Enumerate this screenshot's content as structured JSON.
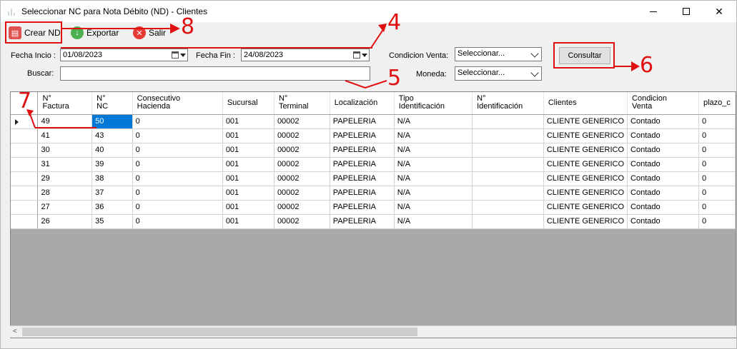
{
  "window": {
    "title": "Seleccionar NC para Nota Débito (ND) - Clientes",
    "minimize_glyph": "—",
    "maximize_glyph": "☐",
    "close_glyph": "✕"
  },
  "toolbar": {
    "crear_label": "Crear ND",
    "exportar_label": "Exportar",
    "salir_label": "Salir"
  },
  "filters": {
    "fecha_inicio_label": "Fecha Incio :",
    "fecha_inicio_value": "01/08/2023",
    "fecha_fin_label": "Fecha Fin :",
    "fecha_fin_value": "24/08/2023",
    "buscar_label": "Buscar:",
    "buscar_value": "",
    "condicion_label": "Condicion Venta:",
    "condicion_value": "Seleccionar...",
    "moneda_label": "Moneda:",
    "moneda_value": "Seleccionar...",
    "consultar_label": "Consultar"
  },
  "annotations": {
    "n4": "4",
    "n5": "5",
    "n6": "6",
    "n7": "7",
    "n8": "8"
  },
  "grid": {
    "columns": [
      "N°\nFactura",
      "N°\nNC",
      "Consecutivo\nHacienda",
      "Sucursal",
      "N°\nTerminal",
      "Localización",
      "Tipo\nIdentificación",
      "N°\nIdentificación",
      "Clientes",
      "Condicion\nVenta",
      "plazo_c"
    ],
    "rows": [
      [
        "49",
        "50",
        "0",
        "001",
        "00002",
        "PAPELERIA",
        "N/A",
        "",
        "CLIENTE GENERICO",
        "Contado",
        "0"
      ],
      [
        "41",
        "43",
        "0",
        "001",
        "00002",
        "PAPELERIA",
        "N/A",
        "",
        "CLIENTE GENERICO",
        "Contado",
        "0"
      ],
      [
        "30",
        "40",
        "0",
        "001",
        "00002",
        "PAPELERIA",
        "N/A",
        "",
        "CLIENTE GENERICO",
        "Contado",
        "0"
      ],
      [
        "31",
        "39",
        "0",
        "001",
        "00002",
        "PAPELERIA",
        "N/A",
        "",
        "CLIENTE GENERICO",
        "Contado",
        "0"
      ],
      [
        "29",
        "38",
        "0",
        "001",
        "00002",
        "PAPELERIA",
        "N/A",
        "",
        "CLIENTE GENERICO",
        "Contado",
        "0"
      ],
      [
        "28",
        "37",
        "0",
        "001",
        "00002",
        "PAPELERIA",
        "N/A",
        "",
        "CLIENTE GENERICO",
        "Contado",
        "0"
      ],
      [
        "27",
        "36",
        "0",
        "001",
        "00002",
        "PAPELERIA",
        "N/A",
        "",
        "CLIENTE GENERICO",
        "Contado",
        "0"
      ],
      [
        "26",
        "35",
        "0",
        "001",
        "00002",
        "PAPELERIA",
        "N/A",
        "",
        "CLIENTE GENERICO",
        "Contado",
        "0"
      ]
    ],
    "scroll_left_glyph": "<"
  },
  "colors": {
    "annotation_red": "#e01010",
    "selection_blue": "#0078d7"
  }
}
